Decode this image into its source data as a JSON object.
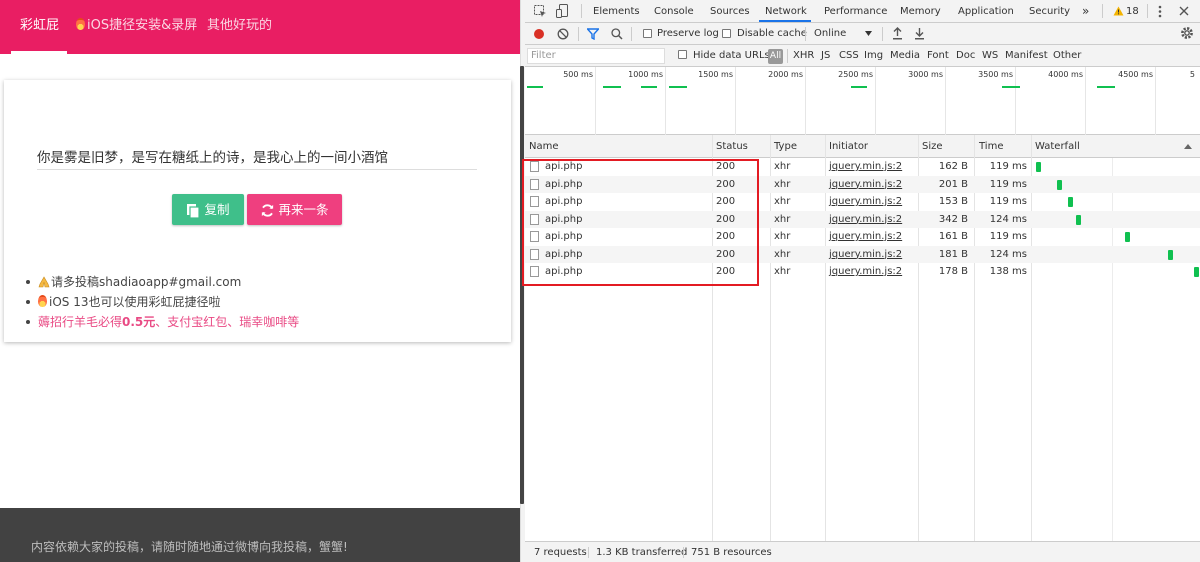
{
  "site": {
    "nav": [
      "彩虹屁",
      "iOS捷径安装&录屏",
      "其他好玩的"
    ],
    "quote": "你是雾是旧梦，是写在糖纸上的诗，是我心上的一间小酒馆",
    "copy_label": "复制",
    "next_label": "再来一条",
    "tips": {
      "submit": "请多投稿shadiaoapp#gmail.com",
      "ios": "iOS 13也可以使用彩虹屁捷径啦",
      "promo_pre": "薅招行羊毛必得",
      "promo_amount": "0.5元",
      "promo_post": "、支付宝红包、瑞幸咖啡等"
    },
    "footer": "内容依赖大家的投稿，请随时随地通过微博向我投稿，蟹蟹!"
  },
  "devtools": {
    "tabs": [
      "Elements",
      "Console",
      "Sources",
      "Network",
      "Performance",
      "Memory",
      "Application",
      "Security"
    ],
    "active_tab": "Network",
    "more": "»",
    "warning_count": "18",
    "toolbar": {
      "preserve_log": "Preserve log",
      "disable_cache": "Disable cache",
      "throttle": "Online"
    },
    "filter": {
      "placeholder": "Filter",
      "hide_data_urls": "Hide data URLs",
      "types": [
        "All",
        "XHR",
        "JS",
        "CSS",
        "Img",
        "Media",
        "Font",
        "Doc",
        "WS",
        "Manifest",
        "Other"
      ]
    },
    "overview_ticks": [
      "500 ms",
      "1000 ms",
      "1500 ms",
      "2000 ms",
      "2500 ms",
      "3000 ms",
      "3500 ms",
      "4000 ms",
      "4500 ms",
      "5"
    ],
    "columns": [
      "Name",
      "Status",
      "Type",
      "Initiator",
      "Size",
      "Time",
      "Waterfall"
    ],
    "rows": [
      {
        "name": "api.php",
        "status": "200",
        "type": "xhr",
        "initiator": "jquery.min.js:2",
        "size": "162 B",
        "time": "119 ms"
      },
      {
        "name": "api.php",
        "status": "200",
        "type": "xhr",
        "initiator": "jquery.min.js:2",
        "size": "201 B",
        "time": "119 ms"
      },
      {
        "name": "api.php",
        "status": "200",
        "type": "xhr",
        "initiator": "jquery.min.js:2",
        "size": "153 B",
        "time": "119 ms"
      },
      {
        "name": "api.php",
        "status": "200",
        "type": "xhr",
        "initiator": "jquery.min.js:2",
        "size": "342 B",
        "time": "124 ms"
      },
      {
        "name": "api.php",
        "status": "200",
        "type": "xhr",
        "initiator": "jquery.min.js:2",
        "size": "161 B",
        "time": "119 ms"
      },
      {
        "name": "api.php",
        "status": "200",
        "type": "xhr",
        "initiator": "jquery.min.js:2",
        "size": "181 B",
        "time": "124 ms"
      },
      {
        "name": "api.php",
        "status": "200",
        "type": "xhr",
        "initiator": "jquery.min.js:2",
        "size": "178 B",
        "time": "138 ms"
      }
    ],
    "status": {
      "requests": "7 requests",
      "transferred": "1.3 KB transferred",
      "resources": "751 B resources"
    }
  },
  "colors": {
    "brand": "#e91e63",
    "copy_button": "#3fbf8a",
    "next_button": "#ef3f7f",
    "request_bar": "#10c050",
    "highlight": "#e31b23"
  }
}
